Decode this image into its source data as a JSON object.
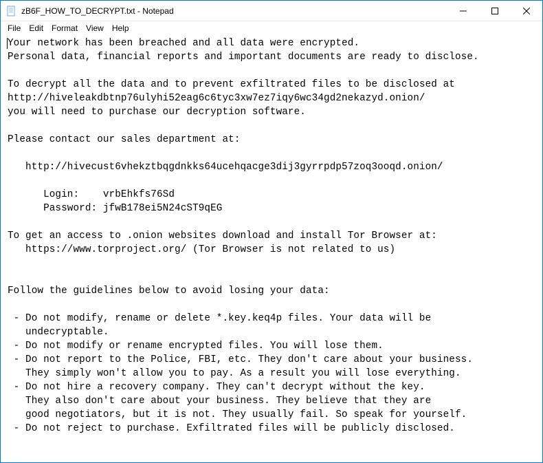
{
  "window": {
    "title": "zB6F_HOW_TO_DECRYPT.txt - Notepad"
  },
  "menu": {
    "file": "File",
    "edit": "Edit",
    "format": "Format",
    "view": "View",
    "help": "Help"
  },
  "content": {
    "line1": "Your network has been breached and all data were encrypted.",
    "line2": "Personal data, financial reports and important documents are ready to disclose.",
    "line3": "",
    "line4": "To decrypt all the data and to prevent exfiltrated files to be disclosed at",
    "line5": "http://hiveleakdbtnp76ulyhi52eag6c6tyc3xw7ez7iqy6wc34gd2nekazyd.onion/",
    "line6": "you will need to purchase our decryption software.",
    "line7": "",
    "line8": "Please contact our sales department at:",
    "line9": "",
    "line10": "   http://hivecust6vhekztbqgdnkks64ucehqacge3dij3gyrrpdp57zoq3ooqd.onion/",
    "line11": "",
    "line12": "      Login:    vrbEhkfs76Sd",
    "line13": "      Password: jfwB178ei5N24cST9qEG",
    "line14": "",
    "line15": "To get an access to .onion websites download and install Tor Browser at:",
    "line16": "   https://www.torproject.org/ (Tor Browser is not related to us)",
    "line17": "",
    "line18": "",
    "line19": "Follow the guidelines below to avoid losing your data:",
    "line20": "",
    "line21": " - Do not modify, rename or delete *.key.keq4p files. Your data will be",
    "line22": "   undecryptable.",
    "line23": " - Do not modify or rename encrypted files. You will lose them.",
    "line24": " - Do not report to the Police, FBI, etc. They don't care about your business.",
    "line25": "   They simply won't allow you to pay. As a result you will lose everything.",
    "line26": " - Do not hire a recovery company. They can't decrypt without the key.",
    "line27": "   They also don't care about your business. They believe that they are",
    "line28": "   good negotiators, but it is not. They usually fail. So speak for yourself.",
    "line29": " - Do not reject to purchase. Exfiltrated files will be publicly disclosed."
  }
}
